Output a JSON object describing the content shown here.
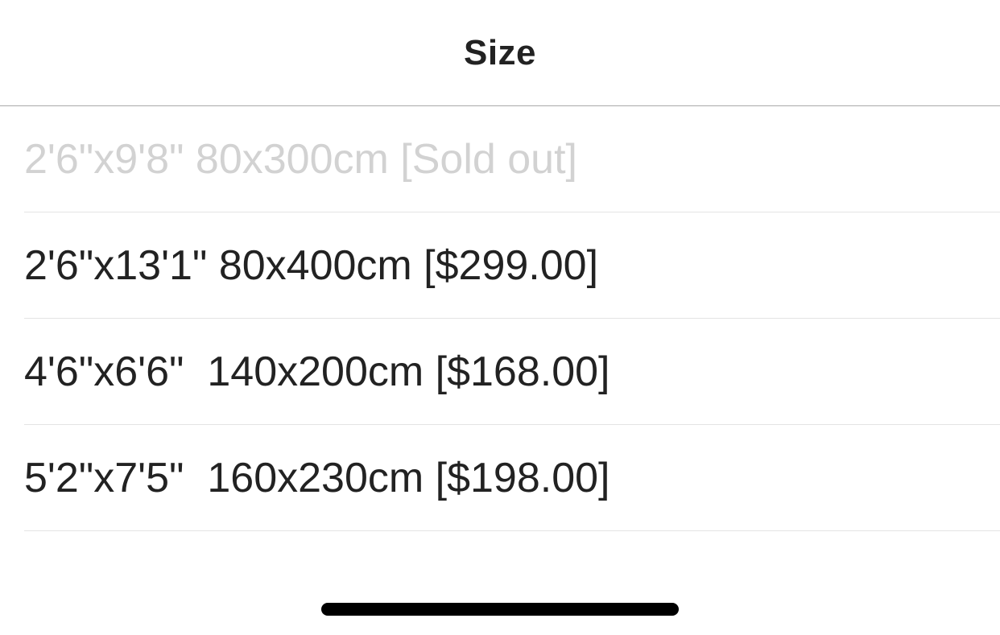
{
  "header": {
    "title": "Size"
  },
  "options": [
    {
      "label": "2'6\"x9'8\" 80x300cm [Sold out]",
      "available": false
    },
    {
      "label": "2'6\"x13'1\" 80x400cm [$299.00]",
      "available": true
    },
    {
      "label": "4'6\"x6'6\"  140x200cm [$168.00]",
      "available": true
    },
    {
      "label": "5'2\"x7'5\"  160x230cm [$198.00]",
      "available": true
    }
  ]
}
